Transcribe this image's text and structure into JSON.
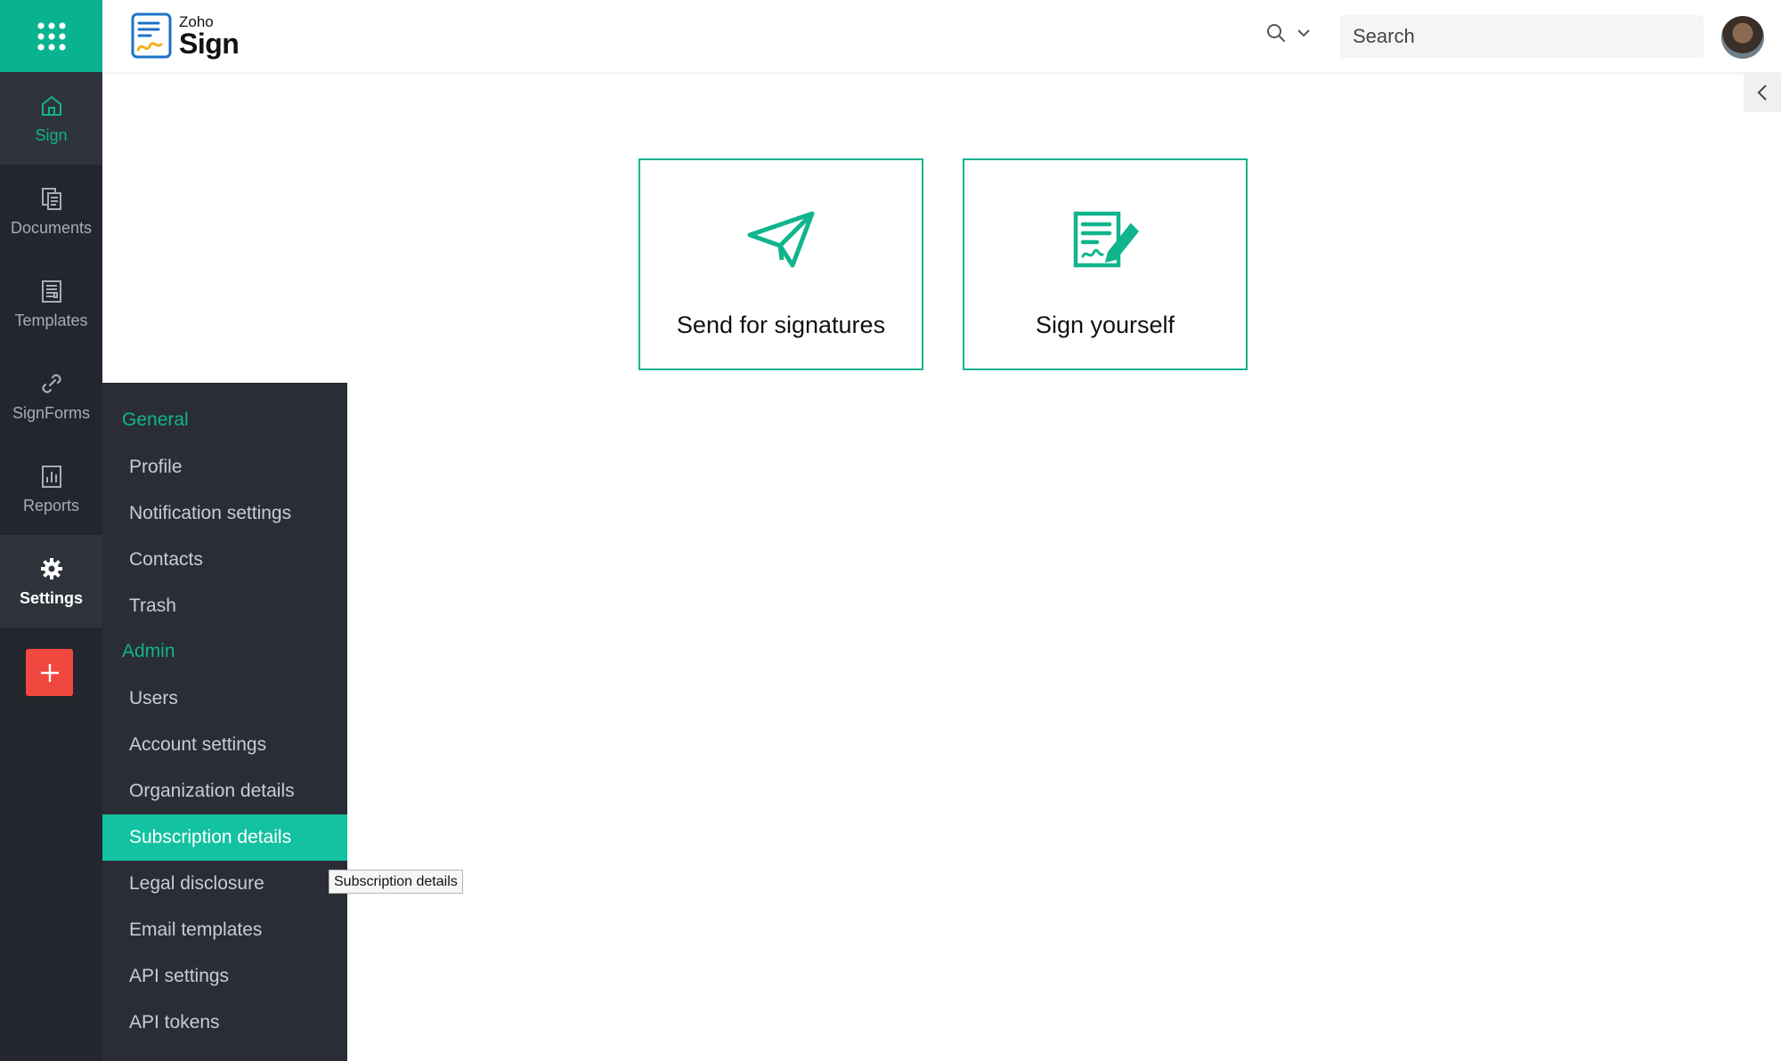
{
  "rail": {
    "items": [
      {
        "label": "Sign",
        "icon": "home-icon"
      },
      {
        "label": "Documents",
        "icon": "documents-icon"
      },
      {
        "label": "Templates",
        "icon": "templates-icon"
      },
      {
        "label": "SignForms",
        "icon": "link-icon"
      },
      {
        "label": "Reports",
        "icon": "reports-icon"
      },
      {
        "label": "Settings",
        "icon": "gear-icon"
      }
    ]
  },
  "header": {
    "logo_brand": "Zoho",
    "logo_product": "Sign",
    "search_placeholder": "Search"
  },
  "cards": [
    {
      "label": "Send for signatures",
      "icon": "paper-plane-icon"
    },
    {
      "label": "Sign yourself",
      "icon": "sign-document-icon"
    }
  ],
  "settings_menu": {
    "general_heading": "General",
    "general_items": [
      "Profile",
      "Notification settings",
      "Contacts",
      "Trash"
    ],
    "admin_heading": "Admin",
    "admin_items": [
      "Users",
      "Account settings",
      "Organization details",
      "Subscription details",
      "Legal disclosure",
      "Email templates",
      "API settings",
      "API tokens"
    ]
  },
  "tooltip": "Subscription details",
  "colors": {
    "accent": "#10b48d",
    "rail": "#23262d",
    "menu": "#2a2d35",
    "add": "#f0483e",
    "selected": "#13c2a0"
  }
}
